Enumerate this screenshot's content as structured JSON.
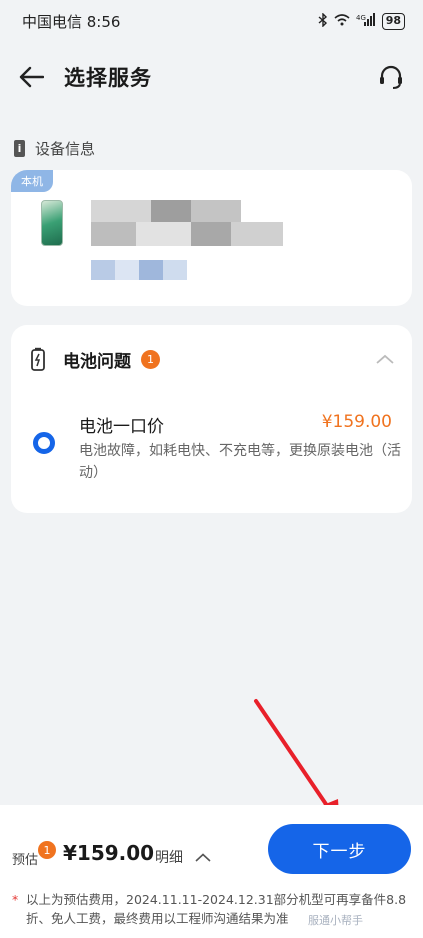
{
  "status_bar": {
    "carrier_time": "中国电信 8:56",
    "signal": "4G",
    "battery": "98"
  },
  "header": {
    "title": "选择服务"
  },
  "device_section": {
    "title": "设备信息",
    "badge": "本机"
  },
  "service": {
    "name": "电池问题",
    "count": "1",
    "option": {
      "title": "电池一口价",
      "price": "¥159.00",
      "description": "电池故障，如耗电快、不充电等，更换原装电池（活动）"
    }
  },
  "bottom": {
    "estimate_label": "预估",
    "estimate_badge": "1",
    "estimate_price": "¥159.00",
    "detail_label": "明细",
    "next_label": "下一步",
    "note": "以上为预估费用，2024.11.11-2024.12.31部分机型可再享备件8.8折、免人工费，最终费用以工程师沟通结果为准"
  },
  "watermark": "服通小帮手",
  "colors": {
    "accent": "#1565e8",
    "price": "#f0731f",
    "background": "#f1f3f5"
  }
}
